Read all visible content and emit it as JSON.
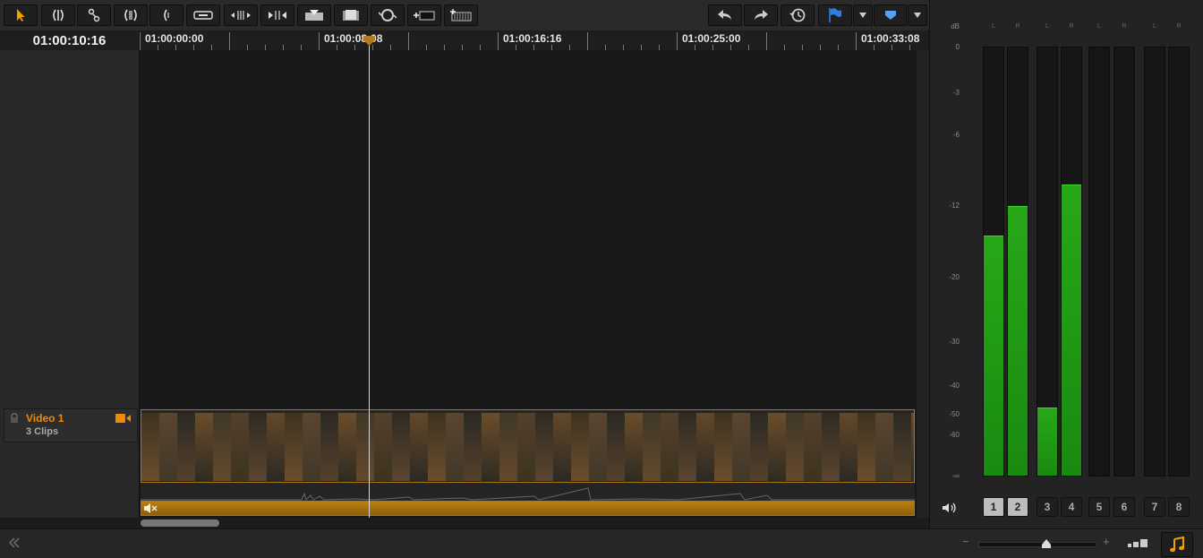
{
  "toolbar": {
    "tools": [
      {
        "name": "select-tool-icon",
        "active": true
      },
      {
        "name": "trim-tool-icon"
      },
      {
        "name": "blade-tool-icon"
      },
      {
        "name": "dynamic-trim-icon"
      },
      {
        "name": "ripple-trim-icon"
      },
      {
        "name": "link-clips-icon"
      },
      {
        "name": "slip-icon"
      },
      {
        "name": "slide-icon"
      },
      {
        "name": "insert-clip-icon"
      },
      {
        "name": "overwrite-clip-icon"
      },
      {
        "name": "replace-clip-icon"
      },
      {
        "name": "place-on-top-icon"
      },
      {
        "name": "fit-to-fill-icon"
      }
    ],
    "right_tools": [
      "undo-icon",
      "redo-icon",
      "history-icon",
      "flag-icon",
      "marker-icon"
    ],
    "accent": "#2f7fe0"
  },
  "timeline": {
    "current_timecode": "01:00:10:16",
    "ruler_labels": [
      "01:00:00:00",
      "01:00:08:08",
      "01:00:16:16",
      "01:00:25:00",
      "01:00:33:08"
    ],
    "playhead_timecode": "01:00:08:08"
  },
  "track": {
    "name": "Video 1",
    "clips_label": "3 Clips",
    "accent": "#f08a00"
  },
  "meters": {
    "unit": "dB",
    "scale": [
      "0",
      "-3",
      "-6",
      "-12",
      "-20",
      "-30",
      "-40",
      "-50",
      "-60",
      "-∞"
    ],
    "channel_lr": [
      "L",
      "R",
      "L",
      "R",
      "L",
      "R",
      "L",
      "R"
    ],
    "levels": [
      0.56,
      0.63,
      0.16,
      0.68,
      0,
      0,
      0,
      0
    ],
    "channels": [
      {
        "label": "1",
        "active": true
      },
      {
        "label": "2",
        "active": true
      },
      {
        "label": "3",
        "active": false
      },
      {
        "label": "4",
        "active": false
      },
      {
        "label": "5",
        "active": false
      },
      {
        "label": "6",
        "active": false
      },
      {
        "label": "7",
        "active": false
      },
      {
        "label": "8",
        "active": false
      }
    ]
  },
  "bottom": {
    "zoom_minus": "−",
    "zoom_plus": "+",
    "zoom_level": 0.58
  }
}
